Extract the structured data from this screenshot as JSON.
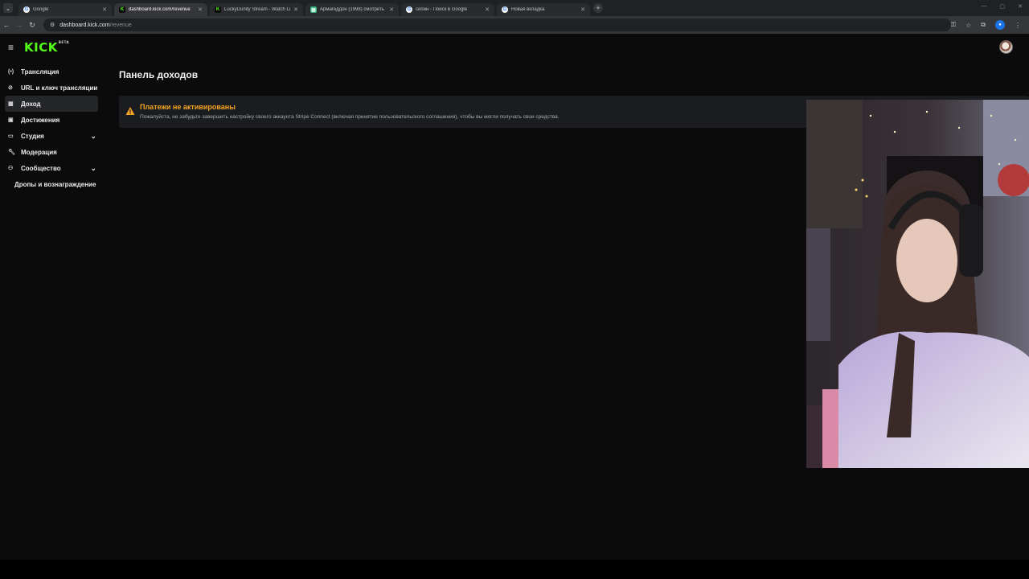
{
  "browser": {
    "tabs": [
      {
        "title": "Google",
        "favicon": "google-icon",
        "active": false
      },
      {
        "title": "dashboard.kick.com/revenue",
        "favicon": "kick-icon",
        "active": true
      },
      {
        "title": "LuckyDunity Stream - Watch Li",
        "favicon": "kick-icon",
        "active": false
      },
      {
        "title": "Армагеддон (1998) смотреть",
        "favicon": "sheet-icon",
        "active": false
      },
      {
        "title": "сепин - Поиск в Google",
        "favicon": "google-icon",
        "active": false
      },
      {
        "title": "Новая вкладка",
        "favicon": "google-icon",
        "active": false
      }
    ],
    "url_host": "dashboard.kick.com",
    "url_path": "/revenue"
  },
  "app": {
    "logo": "KICK",
    "logo_badge": "BETA"
  },
  "sidebar": {
    "items": [
      {
        "label": "Трансляция",
        "icon": "broadcast-icon"
      },
      {
        "label": "URL и ключ трансляции",
        "icon": "link-icon"
      },
      {
        "label": "Доход",
        "icon": "revenue-icon"
      },
      {
        "label": "Достижения",
        "icon": "achievements-icon"
      },
      {
        "label": "Студия",
        "icon": "studio-icon"
      },
      {
        "label": "Модерация",
        "icon": "wrench-icon"
      },
      {
        "label": "Сообщество",
        "icon": "community-icon"
      },
      {
        "label": "Дропы и вознаграждение",
        "icon": ""
      }
    ]
  },
  "main": {
    "title": "Панель доходов",
    "alert": {
      "title": "Платежи не активированы",
      "text": "Пожалуйста, не забудьте завершить настройку своего аккаунта Stripe Connect (включая принятие пользовательского соглашения), чтобы вы могли получать свои средства."
    }
  },
  "colors": {
    "brand": "#53fc18",
    "warning": "#f5a623"
  }
}
